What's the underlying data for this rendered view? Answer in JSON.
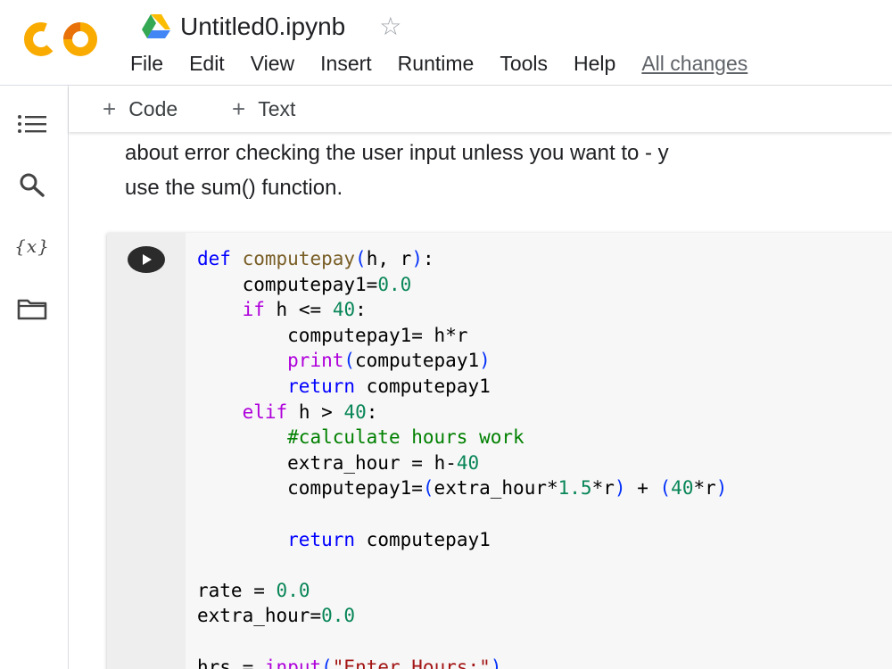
{
  "app": {
    "logo_text": "CO",
    "doc_title": "Untitled0.ipynb",
    "menu": [
      "File",
      "Edit",
      "View",
      "Insert",
      "Runtime",
      "Tools",
      "Help"
    ],
    "save_status": "All changes"
  },
  "colors": {
    "logo_orange": "#f9ab00",
    "logo_dark_orange": "#e8710a"
  },
  "toolbar": {
    "code_label": "Code",
    "text_label": "Text",
    "plus": "+"
  },
  "rail": {
    "icons": [
      "table-of-contents-icon",
      "search-icon",
      "variables-icon",
      "files-icon"
    ],
    "variables_glyph": "{x}"
  },
  "text_cell": {
    "lines": [
      "about error checking the user input unless you want to - y",
      "use the sum() function."
    ]
  },
  "code_cell": {
    "lines": [
      "def computepay(h, r):",
      "    computepay1=0.0",
      "    if h <= 40:",
      "        computepay1= h*r",
      "        print(computepay1)",
      "        return computepay1",
      "    elif h > 40:",
      "        #calculate hours work",
      "        extra_hour = h-40",
      "        computepay1=(extra_hour*1.5*r) + (40*r)",
      "",
      "        return computepay1",
      "",
      "rate = 0.0",
      "extra_hour=0.0",
      "",
      "hrs = input(\"Enter Hours:\")"
    ]
  }
}
